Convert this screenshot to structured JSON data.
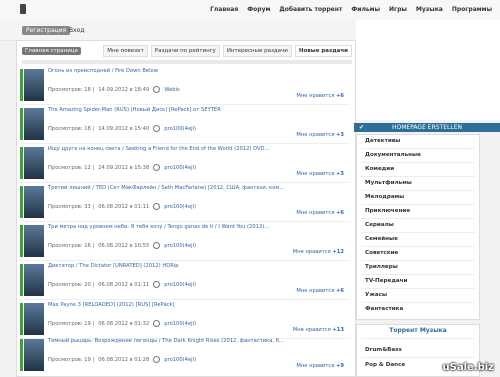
{
  "nav": {
    "items": [
      "Главная",
      "Форум",
      "Добавить торрент",
      "Фильмы",
      "Игры",
      "Музыка",
      "Программы"
    ]
  },
  "auth": {
    "register": "Регистрация",
    "login": "Вход"
  },
  "tabs": {
    "home": "Главная страница",
    "items": [
      "Мне повезет",
      "Раздачи по рейтингу",
      "Интересные раздачи",
      "Новые раздачи"
    ]
  },
  "items": [
    {
      "title": "Огонь из преисподней / Fire Down Below",
      "views": "Просмотров: 18 |",
      "date": "14.09.2012 в 18:49",
      "user": "Webis",
      "likes_label": "Мне нравится",
      "likes": "+6"
    },
    {
      "title": "The Amazing Spider-Man (RUS) (Новый Диск) [RePack] от SEYTER",
      "views": "Просмотров: 18 |",
      "date": "14.09.2012 в 15:40",
      "user": "pro100(4ejl)",
      "likes_label": "Мне нравится",
      "likes": "+3"
    },
    {
      "title": "Ищу друга на конец света / Seeking a Friend for the End of the World (2012) DVD...",
      "views": "Просмотров: 12 |",
      "date": "24.09.2012 в 15:38",
      "user": "pro100(4ejl)",
      "likes_label": "Мне нравится",
      "likes": "+3"
    },
    {
      "title": "Третий лишний / TED (Сет МакФарлейн / Seth MacFarlane) [2012, США, фантези, ком...",
      "views": "Просмотров: 33 |",
      "date": "06.08.2012 в 01:11",
      "user": "pro100(4ejl)",
      "likes_label": "Мне нравится",
      "likes": "+6"
    },
    {
      "title": "Три метра над уровнем неба: Я тебя хочу / Tengo ganas de ti / I Want You (2012)...",
      "views": "Просмотров: 16 |",
      "date": "06.08.2012 в 10:55",
      "user": "pro100(4ejl)",
      "likes_label": "Мне нравится",
      "likes": "+12"
    },
    {
      "title": "Диктатор / The Dictator [UNRATED] (2012) HDRip",
      "views": "Просмотров: 20 |",
      "date": "06.08.2012 в 01:11",
      "user": "pro100(4ejl)",
      "likes_label": "Мне нравится",
      "likes": "+6"
    },
    {
      "title": "Max Payne 3 [RELOADED] (2012) [RUS] [RePack]",
      "views": "Просмотров: 19 |",
      "date": "06.08.2012 в 01:32",
      "user": "pro100(4ejl)",
      "likes_label": "Мне нравится",
      "likes": "+13"
    },
    {
      "title": "Темный рыцарь: Возрождение легенды / The Dark Knight Rises (2012, фантастика, б...",
      "views": "Просмотров: 19 |",
      "date": "06.08.2012 в 01:28",
      "user": "pro100(4ejl)",
      "likes_label": "Мне нравится",
      "likes": "+9"
    }
  ],
  "sidebar": {
    "homepage_label": "HOMEPAGE ERSTELLEN",
    "genres": [
      "Детективы",
      "Документальные",
      "Комедии",
      "Мультфильмы",
      "Мелодрамы",
      "Приключение",
      "Сериалы",
      "Семейные",
      "Советские",
      "Триллеры",
      "TV-Передачи",
      "Ужасы",
      "Фантастика"
    ],
    "music_title": "Торрент Музыка",
    "music_items": [
      "Drum&Bass",
      "Pop & Dance"
    ]
  },
  "watermark": "uSale.biz"
}
